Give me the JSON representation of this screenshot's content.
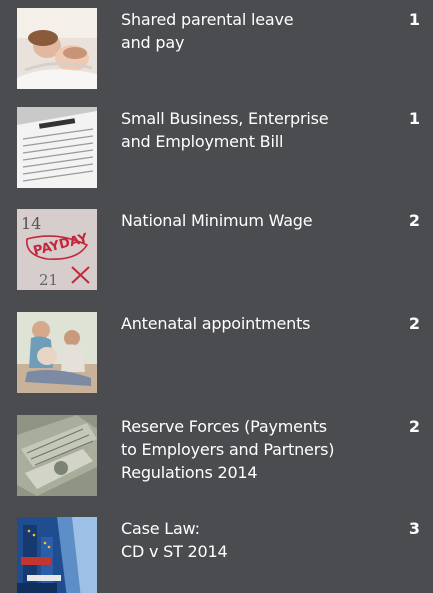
{
  "entries": [
    {
      "title": "Shared parental leave\nand pay",
      "page": "1",
      "thumbnail": "parent-baby-image"
    },
    {
      "title": "Small Business, Enterprise\nand Employment Bill",
      "page": "1",
      "thumbnail": "document-paper-image"
    },
    {
      "title": "National Minimum Wage",
      "page": "2",
      "thumbnail": "payday-calendar-image"
    },
    {
      "title": "Antenatal appointments",
      "page": "2",
      "thumbnail": "pregnant-family-image"
    },
    {
      "title": "Reserve Forces (Payments\nto Employers and Partners)\nRegulations 2014",
      "page": "2",
      "thumbnail": "banknotes-image"
    },
    {
      "title": "Case Law:\nCD v ST 2014",
      "page": "3",
      "thumbnail": "eu-flags-image"
    }
  ]
}
